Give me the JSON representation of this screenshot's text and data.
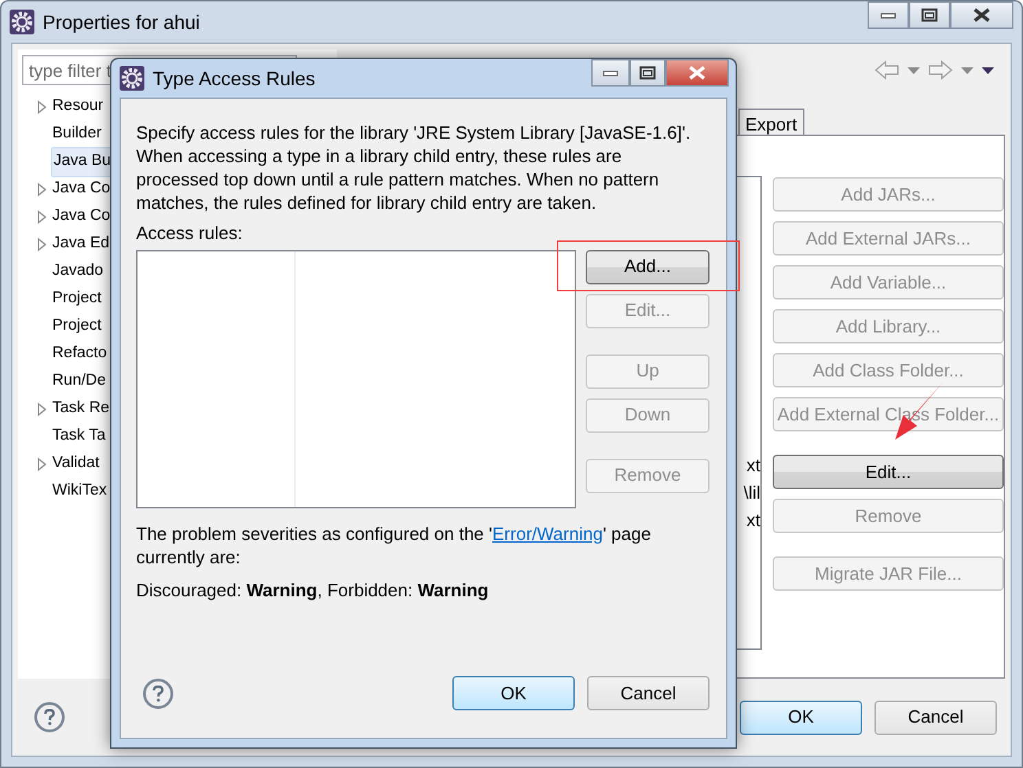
{
  "window": {
    "title": "Properties for ahui"
  },
  "filter": {
    "placeholder": "type filter t"
  },
  "tree": [
    {
      "label": "Resour",
      "expandable": true,
      "selected": false
    },
    {
      "label": "Builder",
      "expandable": false,
      "selected": false
    },
    {
      "label": "Java Bu",
      "expandable": false,
      "selected": true
    },
    {
      "label": "Java Co",
      "expandable": true,
      "selected": false
    },
    {
      "label": "Java Co",
      "expandable": true,
      "selected": false
    },
    {
      "label": "Java Ed",
      "expandable": true,
      "selected": false
    },
    {
      "label": "Javado",
      "expandable": false,
      "selected": false
    },
    {
      "label": "Project",
      "expandable": false,
      "selected": false
    },
    {
      "label": "Project",
      "expandable": false,
      "selected": false
    },
    {
      "label": "Refacto",
      "expandable": false,
      "selected": false
    },
    {
      "label": "Run/De",
      "expandable": false,
      "selected": false
    },
    {
      "label": "Task Re",
      "expandable": true,
      "selected": false
    },
    {
      "label": "Task Ta",
      "expandable": false,
      "selected": false
    },
    {
      "label": "Validat",
      "expandable": true,
      "selected": false
    },
    {
      "label": "WikiTex",
      "expandable": false,
      "selected": false
    }
  ],
  "tabs": [
    {
      "label": "Export",
      "selected": false
    }
  ],
  "list_fragments": [
    "xt",
    "\\lil",
    "xt"
  ],
  "buttons": [
    {
      "label": "Add JARs...",
      "disabled": true,
      "focused": false
    },
    {
      "label": "Add External JARs...",
      "disabled": true,
      "focused": false
    },
    {
      "label": "Add Variable...",
      "disabled": true,
      "focused": false
    },
    {
      "label": "Add Library...",
      "disabled": true,
      "focused": false
    },
    {
      "label": "Add Class Folder...",
      "disabled": true,
      "focused": false
    },
    {
      "label": "Add External Class Folder...",
      "disabled": true,
      "focused": false
    },
    {
      "label": "Edit...",
      "disabled": false,
      "focused": true
    },
    {
      "label": "Remove",
      "disabled": true,
      "focused": false
    },
    {
      "label": "Migrate JAR File...",
      "disabled": true,
      "focused": false
    }
  ],
  "footer_buttons": [
    {
      "label": "OK",
      "default": true
    },
    {
      "label": "Cancel",
      "default": false
    }
  ],
  "dialog": {
    "title": "Type Access Rules",
    "description": "Specify access rules for the library 'JRE System Library [JavaSE-1.6]'. When accessing a type in a library child entry, these rules are processed top down until a rule pattern matches. When no pattern matches, the rules defined for library child entry are taken.",
    "rules_label": "Access rules:",
    "buttons": [
      {
        "label": "Add...",
        "disabled": false,
        "focused": true
      },
      {
        "label": "Edit...",
        "disabled": true,
        "focused": false
      },
      {
        "label": "Up",
        "disabled": true,
        "focused": false
      },
      {
        "label": "Down",
        "disabled": true,
        "focused": false
      },
      {
        "label": "Remove",
        "disabled": true,
        "focused": false
      }
    ],
    "note_before": "The problem severities as configured on the '",
    "note_link": "Error/Warning",
    "note_after": "' page currently are:",
    "severities": "Discouraged: **Warning**, Forbidden: **Warning**",
    "footer_buttons": [
      {
        "label": "OK",
        "default": true
      },
      {
        "label": "Cancel",
        "default": false
      }
    ]
  },
  "annotations": {
    "highlight_box": true,
    "arrow": true
  }
}
